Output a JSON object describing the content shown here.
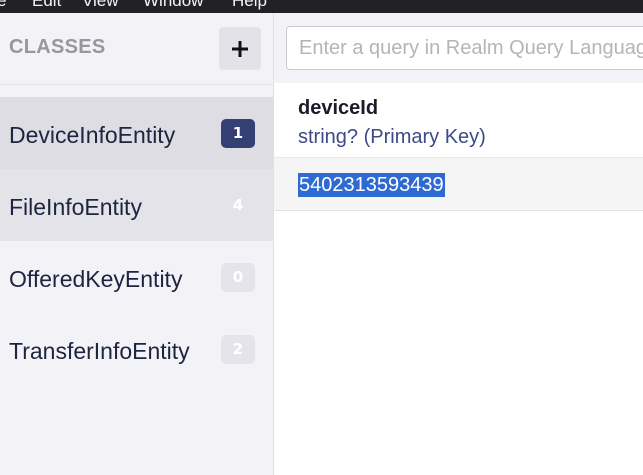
{
  "menubar": {
    "items": [
      "e",
      "Edit",
      "View",
      "Window",
      "Help"
    ]
  },
  "sidebar": {
    "title": "CLASSES",
    "add_label": "+",
    "classes": [
      {
        "name": "DeviceInfoEntity",
        "count": "1"
      },
      {
        "name": "FileInfoEntity",
        "count": "4"
      },
      {
        "name": "OfferedKeyEntity",
        "count": "0"
      },
      {
        "name": "TransferInfoEntity",
        "count": "2"
      }
    ]
  },
  "query": {
    "placeholder": "Enter a query in Realm Query Language"
  },
  "table": {
    "columns": [
      {
        "name": "deviceId",
        "type": "string? (Primary Key)"
      }
    ],
    "rows": [
      {
        "deviceId": "5402313593439"
      }
    ]
  },
  "colors": {
    "active_badge": "#343f73",
    "selection": "#2f6ad3",
    "type_text": "#3d4a86"
  }
}
